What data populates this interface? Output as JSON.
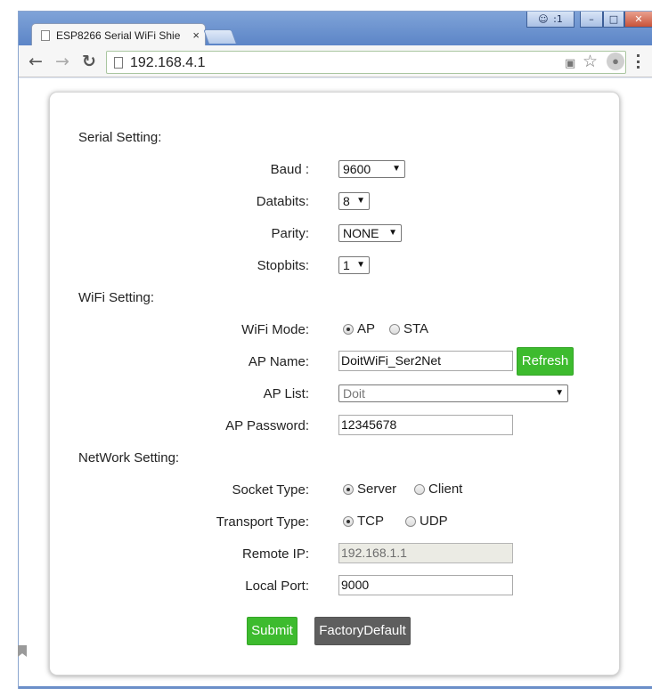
{
  "browser": {
    "tab_title": "ESP8266 Serial WiFi Shie",
    "tab_close": "×",
    "url": "192.168.4.1",
    "user_badge": "☺ :1",
    "window_controls": [
      "–",
      "□",
      "✕"
    ]
  },
  "icons": {
    "back": "←",
    "forward": "→",
    "reload": "↻",
    "star": "☆",
    "translate": "▣",
    "extension": "●"
  },
  "serial": {
    "title": "Serial Setting:",
    "baud_label": "Baud :",
    "baud_value": "9600",
    "databits_label": "Databits:",
    "databits_value": "8",
    "parity_label": "Parity:",
    "parity_value": "NONE",
    "stopbits_label": "Stopbits:",
    "stopbits_value": "1"
  },
  "wifi": {
    "title": "WiFi Setting:",
    "mode_label": "WiFi Mode:",
    "mode_options": [
      "AP",
      "STA"
    ],
    "mode_selected": "AP",
    "ap_name_label": "AP Name:",
    "ap_name_value": "DoitWiFi_Ser2Net",
    "refresh_label": "Refresh",
    "ap_list_label": "AP List:",
    "ap_list_value": "Doit",
    "ap_password_label": "AP Password:",
    "ap_password_value": "12345678"
  },
  "network": {
    "title": "NetWork Setting:",
    "socket_label": "Socket Type:",
    "socket_options": [
      "Server",
      "Client"
    ],
    "socket_selected": "Server",
    "transport_label": "Transport Type:",
    "transport_options": [
      "TCP",
      "UDP"
    ],
    "transport_selected": "TCP",
    "remote_ip_label": "Remote IP:",
    "remote_ip_value": "192.168.1.1",
    "local_port_label": "Local Port:",
    "local_port_value": "9000"
  },
  "actions": {
    "submit_label": "Submit",
    "factory_default_label": "FactoryDefault"
  },
  "colors": {
    "accent_green": "#3dbb2e",
    "button_gray": "#5e5e5e",
    "chrome_blue": "#6b8fc9"
  }
}
